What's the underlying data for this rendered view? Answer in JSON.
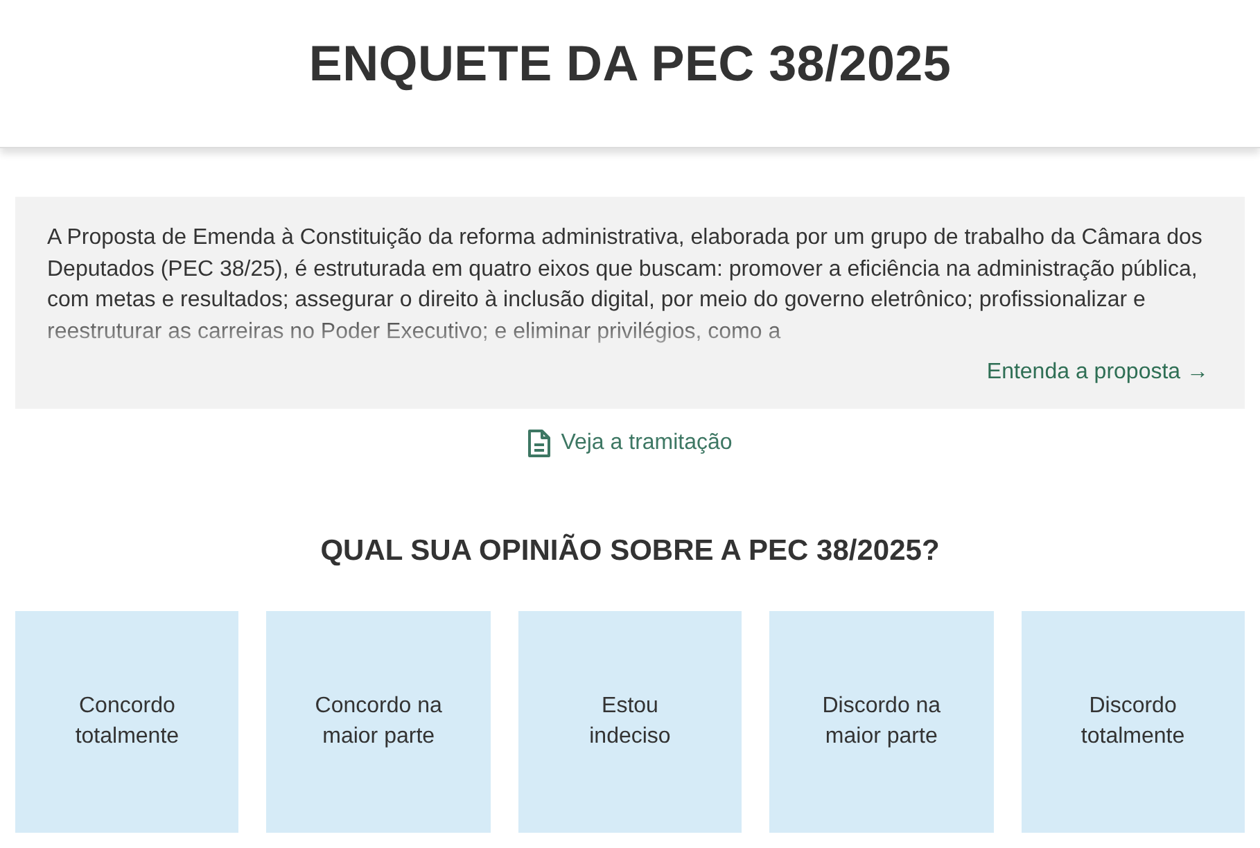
{
  "header": {
    "title": "ENQUETE DA PEC 38/2025"
  },
  "summary": {
    "text": "A Proposta de Emenda à Constituição da reforma administrativa, elaborada por um grupo de trabalho da Câmara dos Deputados (PEC 38/25), é estruturada em quatro eixos que buscam: promover a eficiência na administração pública, com metas e resultados; assegurar o direito à inclusão digital, por meio do governo eletrônico; profissionalizar e reestruturar as carreiras no Poder Executivo; e eliminar privilégios, como a",
    "link": "Entenda a proposta →"
  },
  "tramitacao_link": {
    "label": "Veja a tramitação"
  },
  "poll": {
    "question": "QUAL SUA OPINIÃO SOBRE A PEC 38/2025?",
    "options": [
      {
        "label": "Concordo totalmente"
      },
      {
        "label": "Concordo na maior parte"
      },
      {
        "label": "Estou indeciso"
      },
      {
        "label": "Discordo na maior parte"
      },
      {
        "label": "Discordo totalmente"
      }
    ]
  }
}
